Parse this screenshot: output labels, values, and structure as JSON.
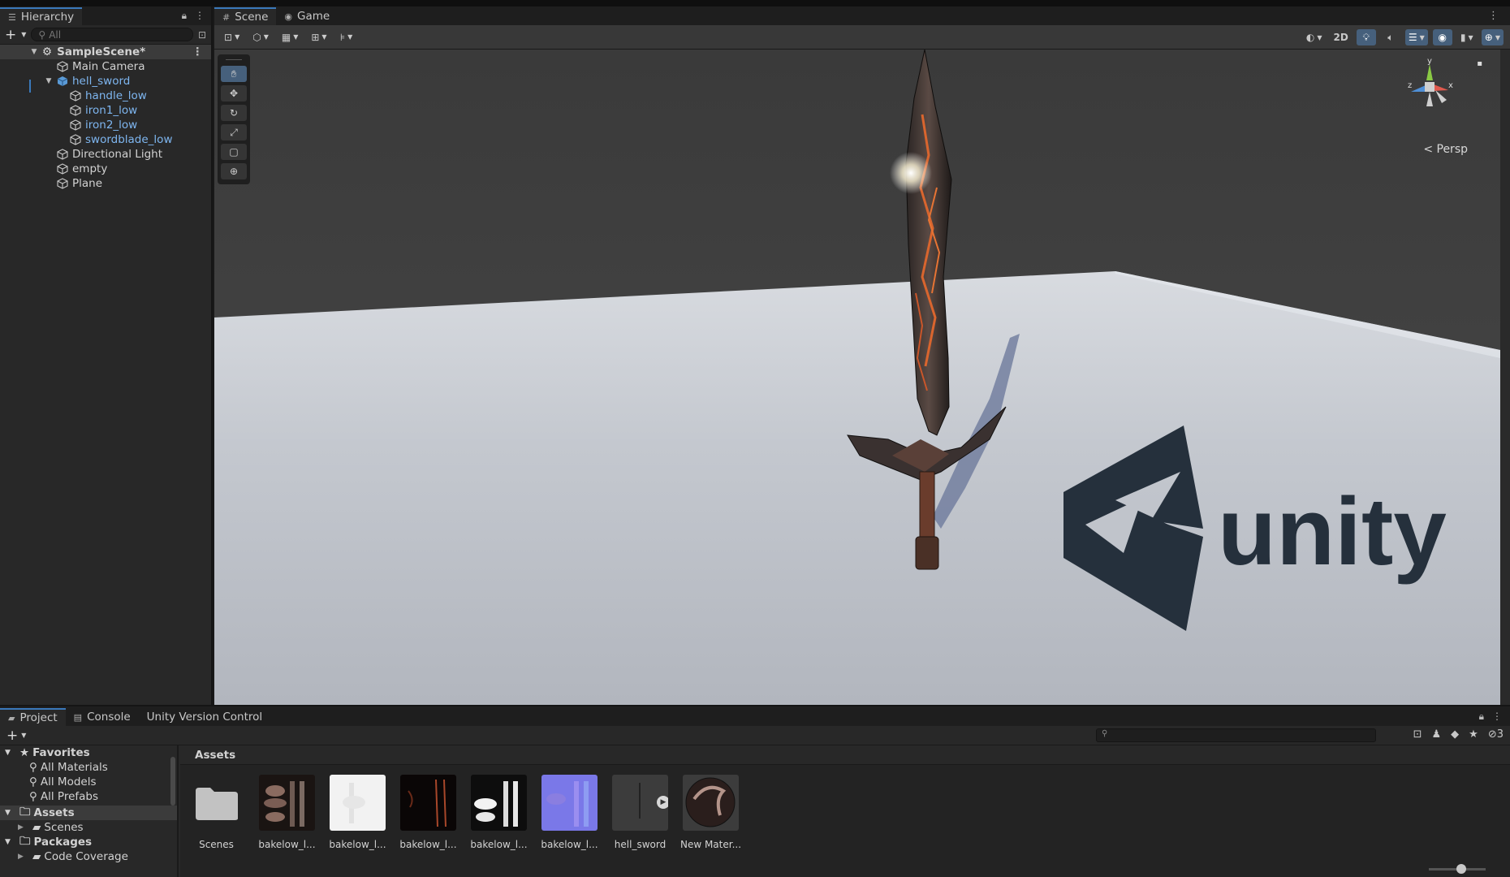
{
  "hierarchy": {
    "tab_label": "Hierarchy",
    "search_placeholder": "All",
    "scene_name": "SampleScene*",
    "items": [
      {
        "label": "Main Camera"
      },
      {
        "label": "hell_sword"
      },
      {
        "label": "handle_low"
      },
      {
        "label": "iron1_low"
      },
      {
        "label": "iron2_low"
      },
      {
        "label": "swordblade_low"
      },
      {
        "label": "Directional Light"
      },
      {
        "label": "empty"
      },
      {
        "label": "Plane"
      }
    ]
  },
  "scene_view": {
    "tabs": [
      {
        "label": "Scene"
      },
      {
        "label": "Game"
      }
    ],
    "toolbar_2d_label": "2D",
    "gizmo_label": "Persp",
    "gizmo_axes": {
      "y": "y",
      "z": "z",
      "x": "x"
    },
    "logo_text": "unity"
  },
  "project": {
    "tabs": [
      {
        "label": "Project"
      },
      {
        "label": "Console"
      },
      {
        "label": "Unity Version Control"
      }
    ],
    "hidden_count": "3",
    "favorites_label": "Favorites",
    "favorites": [
      {
        "label": "All Materials"
      },
      {
        "label": "All Models"
      },
      {
        "label": "All Prefabs"
      }
    ],
    "assets_label": "Assets",
    "scenes_label": "Scenes",
    "packages_label": "Packages",
    "code_coverage_label": "Code Coverage",
    "breadcrumb": "Assets",
    "asset_items": [
      {
        "label": "Scenes"
      },
      {
        "label": "bakelow_l..."
      },
      {
        "label": "bakelow_l..."
      },
      {
        "label": "bakelow_l..."
      },
      {
        "label": "bakelow_l..."
      },
      {
        "label": "bakelow_l..."
      },
      {
        "label": "hell_sword"
      },
      {
        "label": "New Mater..."
      }
    ]
  },
  "colors": {
    "accent": "#3a79bb",
    "prefab_text": "#7eb6f0",
    "panel_bg": "#282828",
    "toolbar_on": "#46607c"
  }
}
